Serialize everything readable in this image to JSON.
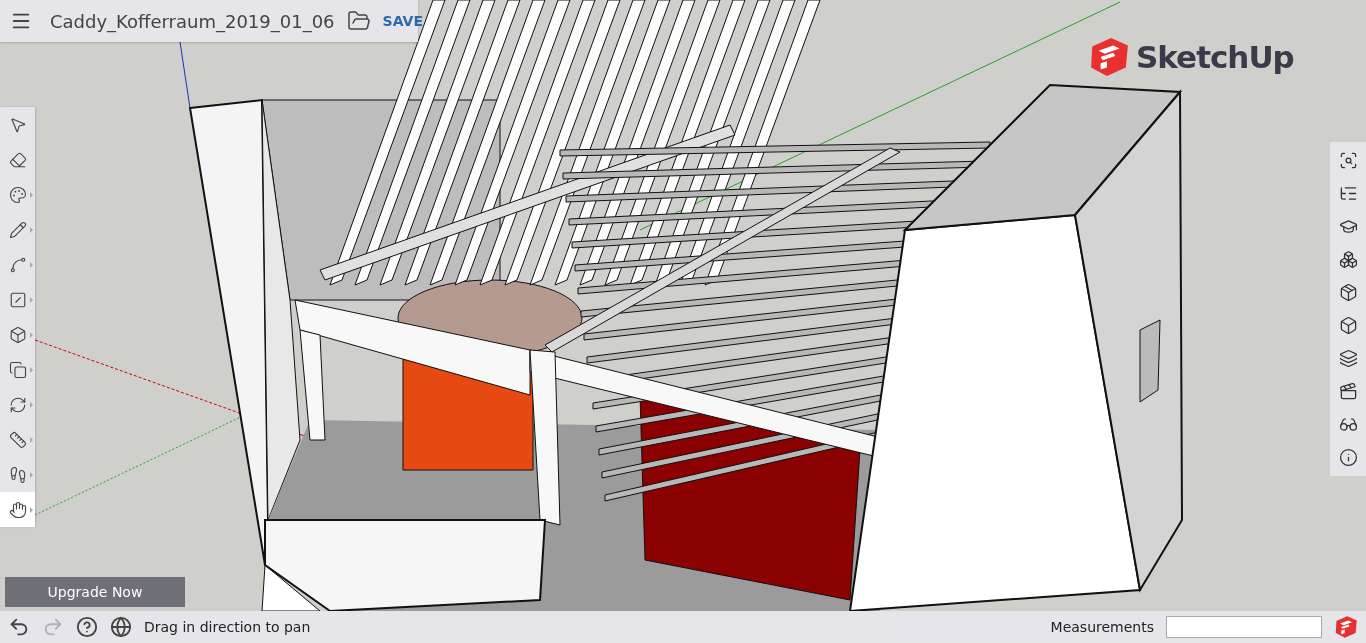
{
  "file": {
    "title": "Caddy_Kofferraum_2019_01_06",
    "save": "SAVE"
  },
  "logo": {
    "text": "SketchUp"
  },
  "left_tools": [
    {
      "kind": "select",
      "selected": false
    },
    {
      "kind": "eraser",
      "selected": false
    },
    {
      "kind": "paint",
      "selected": false
    },
    {
      "kind": "pencil",
      "selected": false
    },
    {
      "kind": "arc",
      "selected": false
    },
    {
      "kind": "rectangle",
      "selected": false
    },
    {
      "kind": "pushpull",
      "selected": false
    },
    {
      "kind": "offset",
      "selected": false
    },
    {
      "kind": "orbit",
      "selected": false
    },
    {
      "kind": "tape",
      "selected": false
    },
    {
      "kind": "walk",
      "selected": false
    },
    {
      "kind": "pan",
      "selected": true
    }
  ],
  "right_panels": [
    {
      "kind": "entity"
    },
    {
      "kind": "outliner"
    },
    {
      "kind": "instructor"
    },
    {
      "kind": "components"
    },
    {
      "kind": "materials"
    },
    {
      "kind": "styles"
    },
    {
      "kind": "layers"
    },
    {
      "kind": "scenes"
    },
    {
      "kind": "display"
    },
    {
      "kind": "info"
    }
  ],
  "upgrade": "Upgrade Now",
  "status_bar": {
    "undo": {
      "disabled": false
    },
    "redo": {
      "disabled": true
    },
    "hint": "Drag in direction to pan",
    "measurements_label": "Measurements"
  }
}
